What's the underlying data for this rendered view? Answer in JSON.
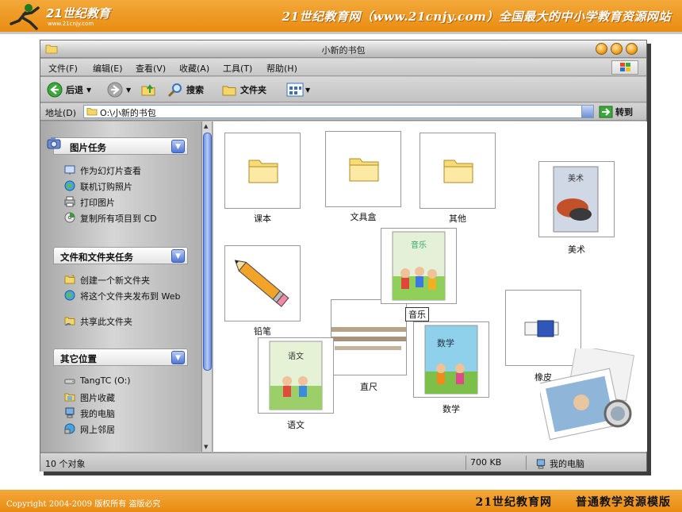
{
  "slide": {
    "logo_text": "21世纪教育",
    "logo_url": "www.21cnjy.com",
    "tagline": "21世纪教育网（www.21cnjy.com）全国最大的中小学教育资源网站",
    "copyright": "Copyright 2004-2009 版权所有 盗版必究",
    "footer_site": "21世纪教育网",
    "footer_template": "普通教学资源模版"
  },
  "window": {
    "title": "小新的书包",
    "menu": [
      "文件(F)",
      "编辑(E)",
      "查看(V)",
      "收藏(A)",
      "工具(T)",
      "帮助(H)"
    ],
    "toolbar": {
      "back": "后退",
      "search": "搜索",
      "folders": "文件夹"
    },
    "address": {
      "label": "地址(D)",
      "value": "O:\\小新的书包",
      "go": "转到"
    }
  },
  "sidebar": {
    "picture_tasks": {
      "title": "图片任务",
      "items": [
        "作为幻灯片查看",
        "联机订购照片",
        "打印图片",
        "复制所有项目到 CD"
      ]
    },
    "file_tasks": {
      "title": "文件和文件夹任务",
      "items": [
        "创建一个新文件夹",
        "将这个文件夹发布到 Web",
        "共享此文件夹"
      ]
    },
    "other_places": {
      "title": "其它位置",
      "items": [
        "TangTC (O:)",
        "图片收藏",
        "我的电脑",
        "网上邻居"
      ]
    }
  },
  "content": {
    "items": [
      {
        "label": "课本",
        "kind": "folder"
      },
      {
        "label": "文具盒",
        "kind": "folder"
      },
      {
        "label": "其他",
        "kind": "folder"
      },
      {
        "label": "美术",
        "kind": "image",
        "cover_title": "美术"
      },
      {
        "label": "铅笔",
        "kind": "image"
      },
      {
        "label": "音乐",
        "kind": "image",
        "cover_title": "音乐"
      },
      {
        "label": "直尺",
        "kind": "image"
      },
      {
        "label": "橡皮",
        "kind": "image"
      },
      {
        "label": "语文",
        "kind": "image",
        "cover_title": "语文"
      },
      {
        "label": "数学",
        "kind": "image",
        "cover_title": "数学"
      }
    ]
  },
  "statusbar": {
    "count": "10 个对象",
    "size": "700 KB",
    "zone": "我的电脑"
  },
  "colors": {
    "brand_orange": "#ee9a20",
    "xp_blue": "#4d76d6",
    "window_gray": "#c4c4c4"
  }
}
